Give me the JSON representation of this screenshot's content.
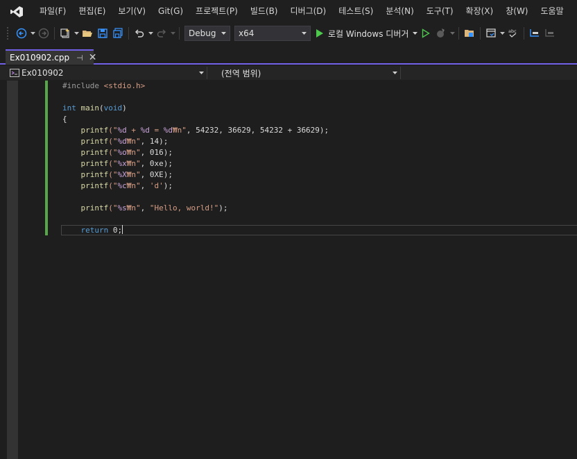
{
  "menu": {
    "items": [
      "파일(F)",
      "편집(E)",
      "보기(V)",
      "Git(G)",
      "프로젝트(P)",
      "빌드(B)",
      "디버그(D)",
      "테스트(S)",
      "분석(N)",
      "도구(T)",
      "확장(X)",
      "창(W)",
      "도움말"
    ]
  },
  "toolbar": {
    "configuration": "Debug",
    "platform": "x64",
    "run_label": "로컬 Windows 디버거"
  },
  "tab": {
    "filename": "Ex010902.cpp",
    "pin_glyph": "⊣",
    "close_glyph": "✕"
  },
  "navbar": {
    "project": "Ex010902",
    "scope": "(전역 범위)"
  },
  "code": {
    "l1_directive": "#include ",
    "l1_header": "<stdio.h>",
    "l3_type": "int",
    "l3_name": " main",
    "l3_paren_open": "(",
    "l3_param": "void",
    "l3_paren_close": ")",
    "l4": "{",
    "p_fn": "printf",
    "l5_a": "(\"",
    "l5_f1": "%d",
    "l5_s1": " + ",
    "l5_f2": "%d",
    "l5_s2": " = ",
    "l5_f3": "%d",
    "l5_s3": "₩n\"",
    "l5_args": ", 54232, 36629, 54232 + 36629);",
    "l6_f": "%d",
    "l6_s": "₩n\"",
    "l6_args": ", 14);",
    "l7_f": "%o",
    "l7_s": "₩n\"",
    "l7_args": ", 016);",
    "l8_f": "%x",
    "l8_s": "₩n\"",
    "l8_args": ", 0xe);",
    "l9_f": "%X",
    "l9_s": "₩n\"",
    "l9_args": ", 0XE);",
    "l10_f": "%c",
    "l10_s": "₩n\"",
    "l10_args_a": ", ",
    "l10_char": "'d'",
    "l10_args_b": ");",
    "l12_f": "%s",
    "l12_s": "₩n\"",
    "l12_args_a": ", ",
    "l12_str": "\"Hello, world!\"",
    "l12_args_b": ");",
    "l14_kw": "return",
    "l14_val": " 0;",
    "open_quote": "(\""
  },
  "colors": {
    "accent": "#7160e8",
    "change_bar": "#57a64a",
    "keyword": "#569cd6",
    "string": "#d69d85"
  }
}
